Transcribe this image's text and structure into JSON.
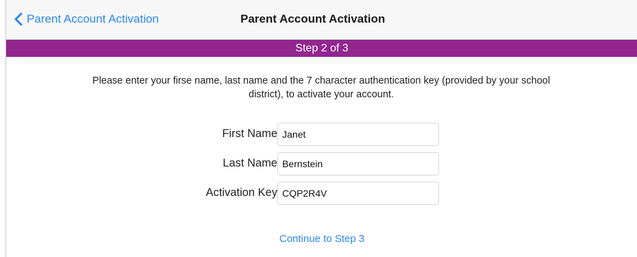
{
  "nav": {
    "back_label": "Parent Account Activation",
    "title": "Parent Account Activation"
  },
  "step": {
    "label": "Step 2 of 3",
    "color": "#92278f"
  },
  "instructions": {
    "line1": "Please enter your firse name, last name and the 7 character authentication key (provided by your school",
    "line2": "district), to activate your account."
  },
  "form": {
    "first_name": {
      "label": "First Name",
      "value": "Janet"
    },
    "last_name": {
      "label": "Last Name",
      "value": "Bernstein"
    },
    "activation_key": {
      "label": "Activation Key",
      "value": "CQP2R4V"
    }
  },
  "actions": {
    "continue_label": "Continue to Step 3"
  },
  "colors": {
    "accent": "#2b87f0",
    "step_bar": "#92278f"
  },
  "icons": {
    "back": "chevron-left-icon"
  }
}
